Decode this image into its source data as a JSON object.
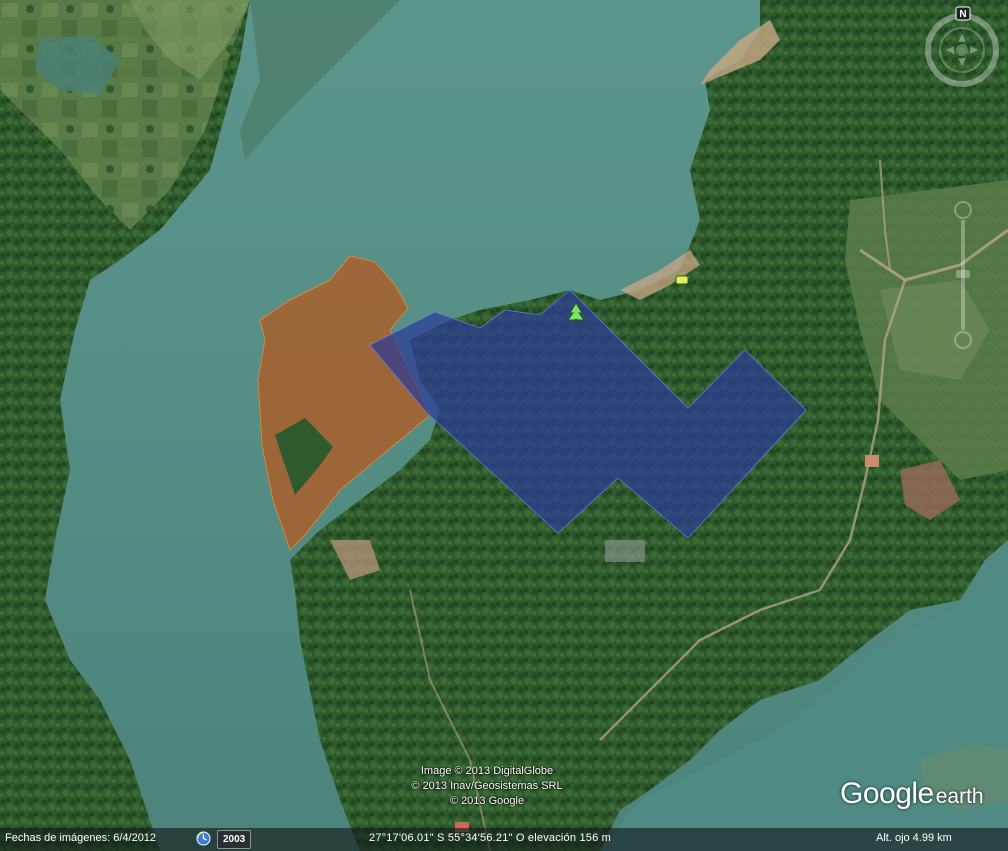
{
  "app": {
    "logo_text_google": "Google",
    "logo_text_earth": "earth"
  },
  "credits": [
    "Image © 2013 DigitalGlobe",
    "© 2013 Inav/Geosistemas SRL",
    "© 2013 Google"
  ],
  "status_bar": {
    "imagery_date": "Fechas de imágenes: 6/4/2012",
    "year": "2003",
    "coordinates": "27°17'06.01\" S  55°34'56.21\" O elevación   156 m",
    "eye_altitude": "Alt. ojo    4.99 km"
  },
  "navigation": {
    "compass_north_label": "N"
  },
  "overlays": [
    {
      "name": "brown-polygon",
      "color": "#b9581c"
    },
    {
      "name": "blue-polygon",
      "color": "#2c3c97"
    }
  ],
  "placemarks": [
    {
      "name": "tree-placemark",
      "icon": "tree-icon",
      "color": "#7be36a"
    }
  ],
  "colors": {
    "water": "#4f8a82",
    "forest": "#2f5a2e",
    "status_bar": "#141a1c"
  }
}
